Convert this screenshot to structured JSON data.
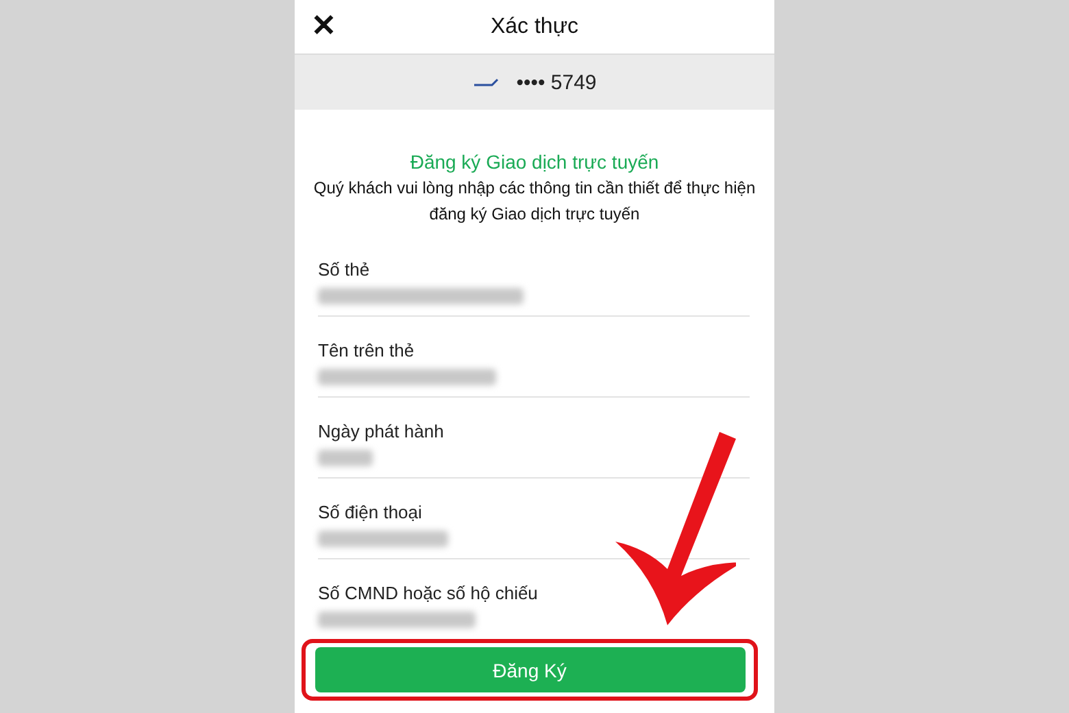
{
  "header": {
    "title": "Xác thực",
    "close_icon": "✕"
  },
  "card": {
    "number": "•••• 5749"
  },
  "form": {
    "title": "Đăng ký Giao dịch trực tuyến",
    "description": "Quý khách vui lòng nhập các thông tin cần thiết để thực hiện đăng ký Giao dịch trực tuyến",
    "fields": [
      {
        "label": "Số thẻ"
      },
      {
        "label": "Tên trên thẻ"
      },
      {
        "label": "Ngày phát hành"
      },
      {
        "label": "Số điện thoại"
      },
      {
        "label": "Số CMND hoặc số hộ chiếu"
      }
    ]
  },
  "submit": {
    "label": "Đăng Ký"
  }
}
